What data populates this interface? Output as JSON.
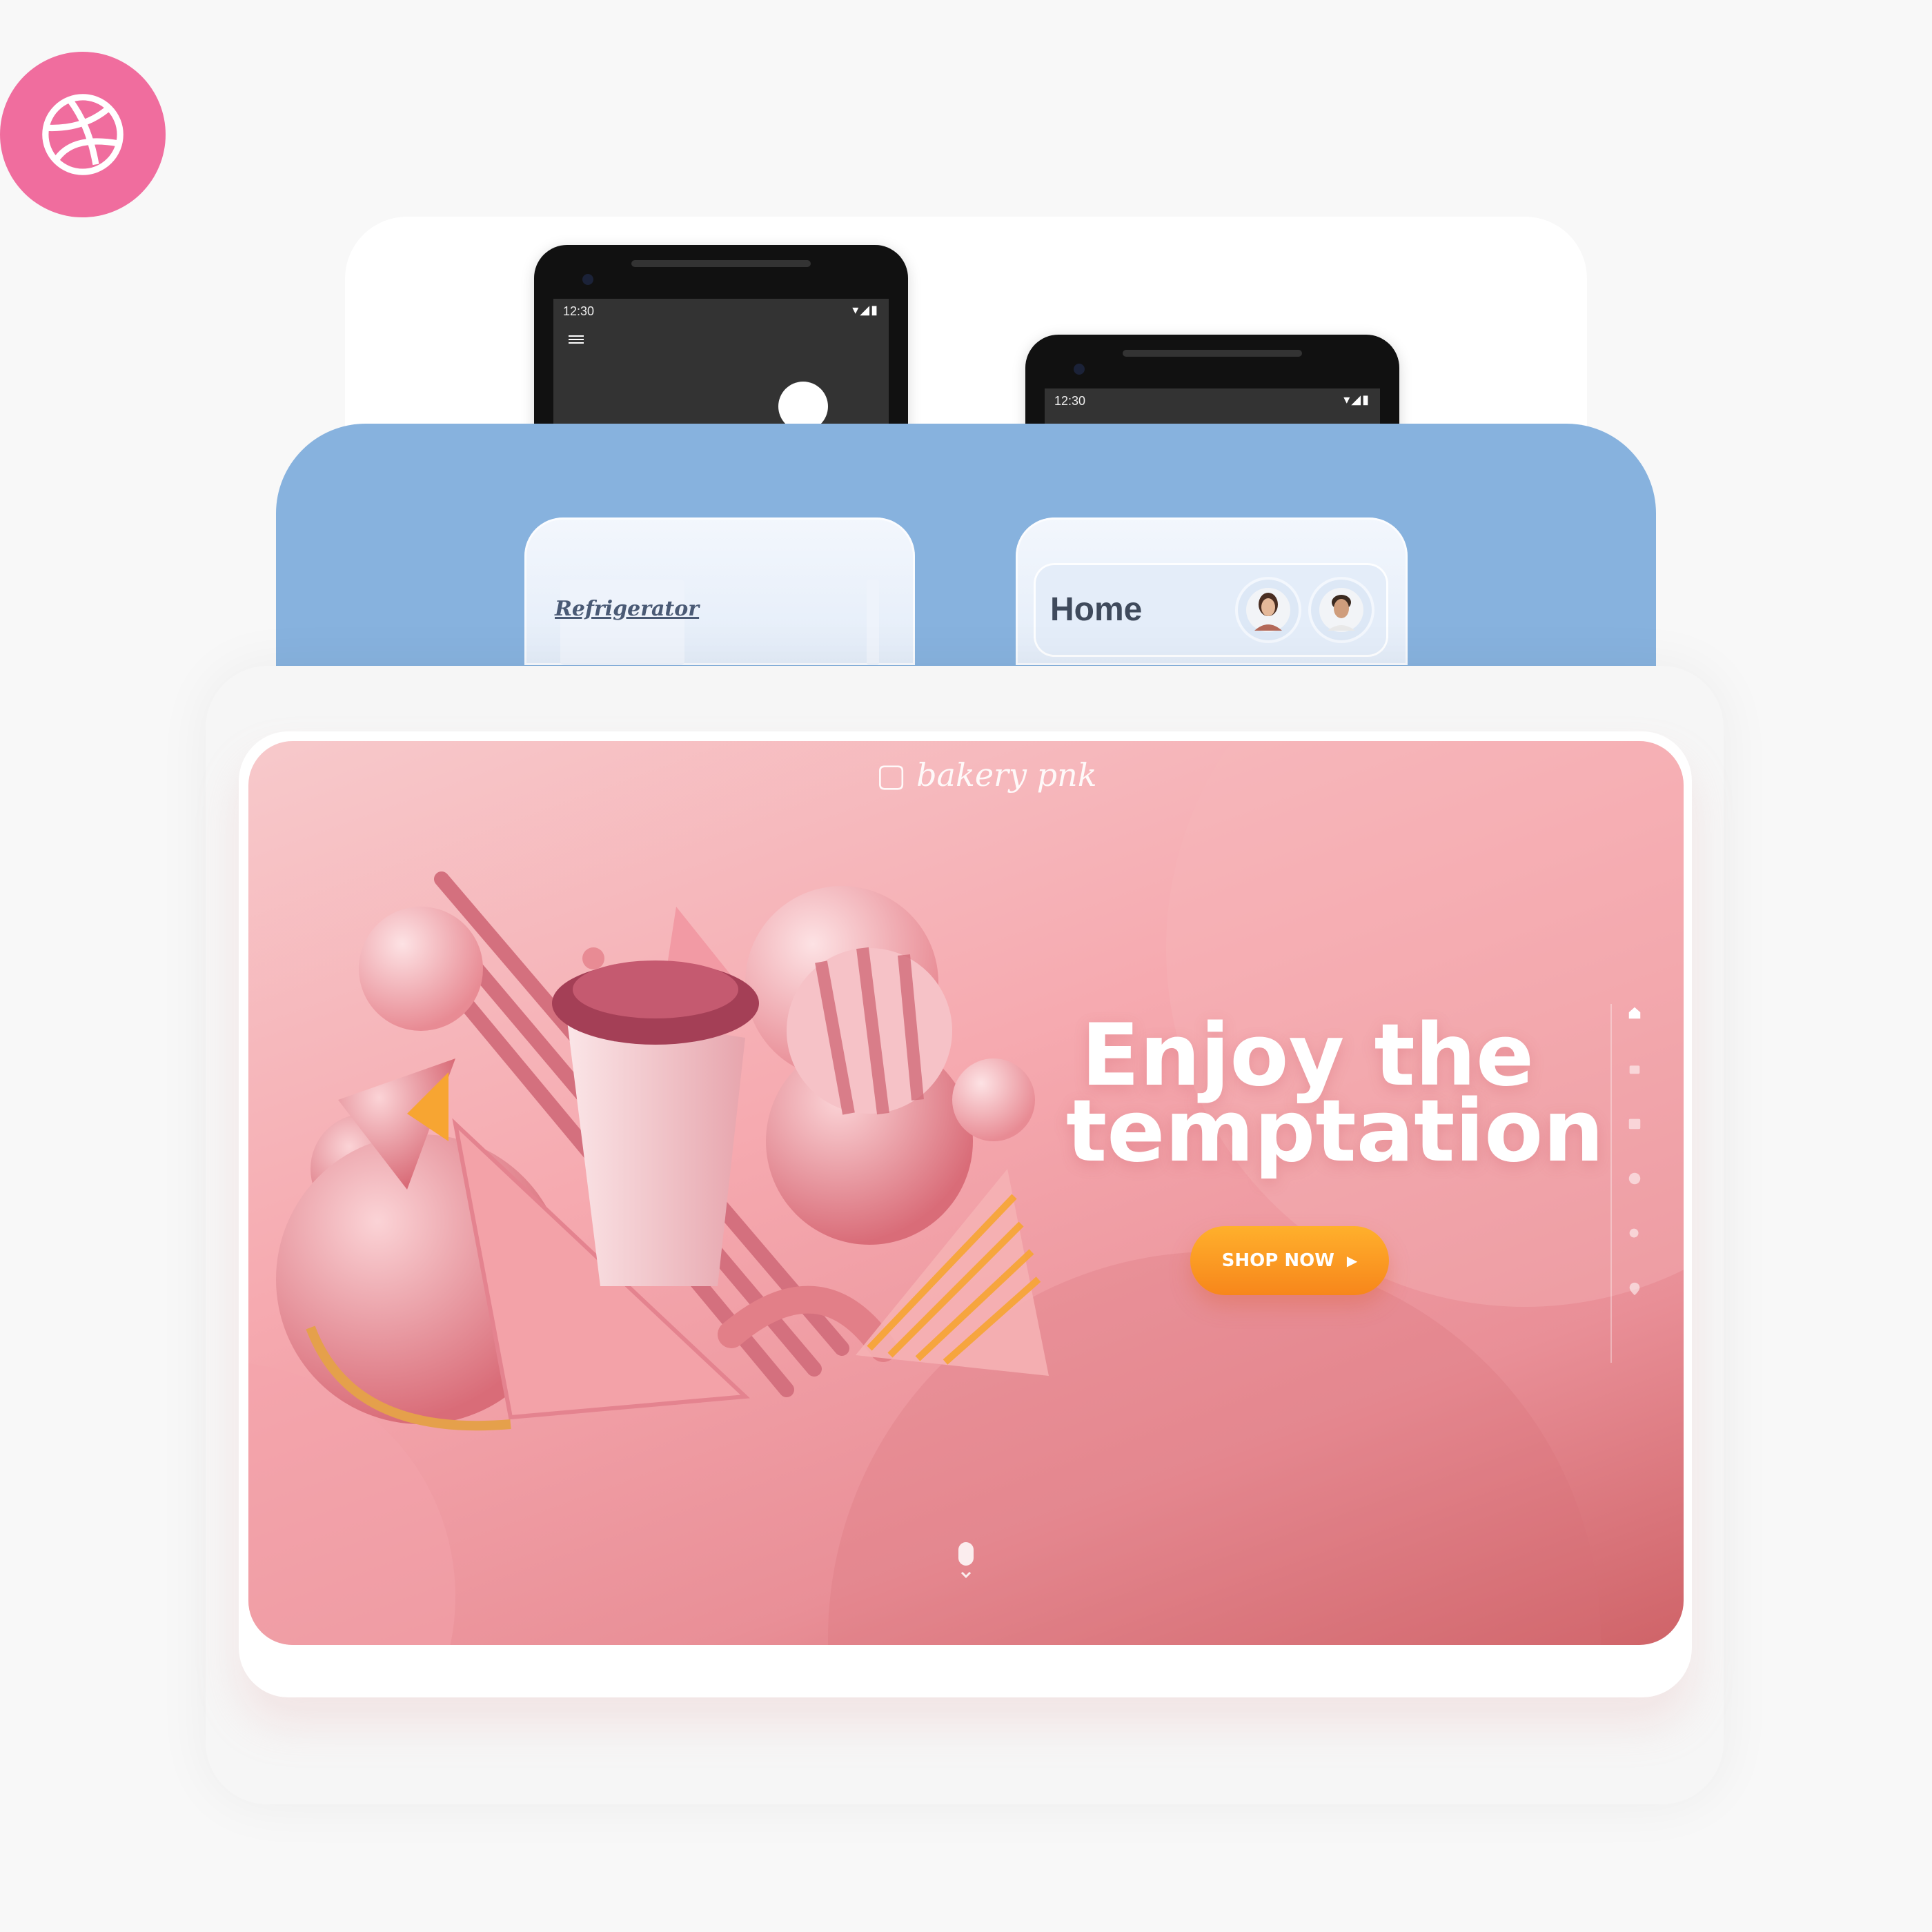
{
  "badge": {
    "icon": "dribbble-icon"
  },
  "phones": [
    {
      "time": "12:30",
      "status": "▾◢▮",
      "menu_icon": "hamburger-menu-icon"
    },
    {
      "time": "12:30",
      "status": "▾◢▮"
    }
  ],
  "widgets": {
    "fridge_label": "Refrigerator",
    "home_title": "Home",
    "avatars": [
      "avatar-woman",
      "avatar-man"
    ]
  },
  "hero": {
    "logo": "bakery pnk",
    "headline_line1": "Enjoy the",
    "headline_line2": "temptation",
    "cta_label": "SHOP NOW",
    "nav_icons": [
      "home-icon",
      "bag-icon",
      "calendar-icon",
      "chat-icon",
      "search-icon",
      "location-icon"
    ],
    "colors": {
      "cta": "#f7861b",
      "hero_bg": "#f6aab0",
      "badge": "#f06d9e",
      "blue_panel": "#87b2de"
    }
  }
}
